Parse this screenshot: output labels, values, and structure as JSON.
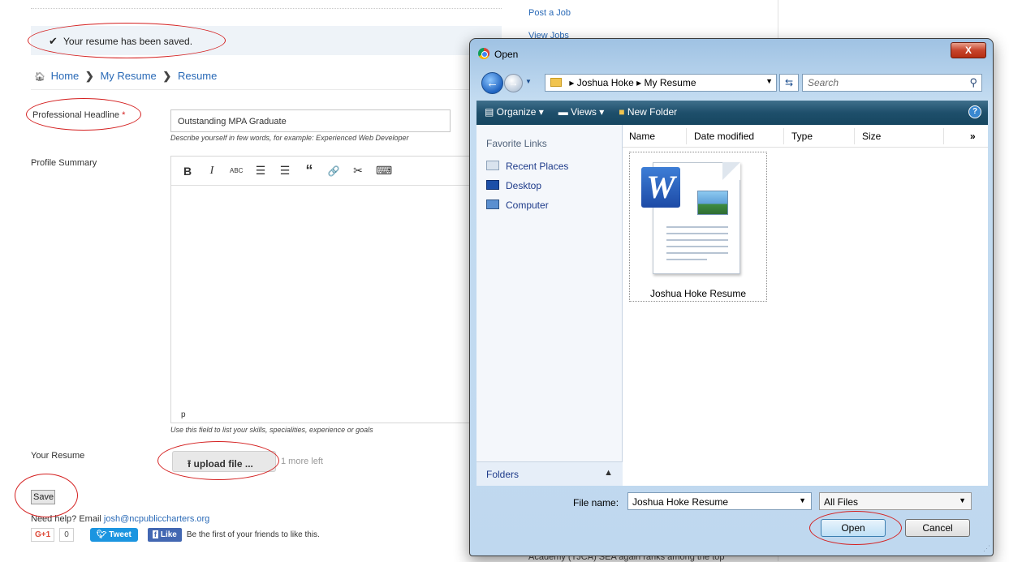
{
  "webpage": {
    "alert_message": "Your resume has been saved.",
    "breadcrumb": [
      "Home",
      "My Resume",
      "Resume"
    ],
    "headline_label": "Professional Headline",
    "headline_required_mark": "*",
    "headline_value": "Outstanding MPA Graduate",
    "headline_help": "Describe yourself in few words, for example: Experienced Web Developer",
    "summary_label": "Profile Summary",
    "editor_toolbar_icons": [
      "bold-icon",
      "italic-icon",
      "strikethrough-icon",
      "bulleted-list-icon",
      "numbered-list-icon",
      "quote-icon",
      "link-icon",
      "unlink-icon",
      "keyboard-icon"
    ],
    "editor_toolbar_glyphs": {
      "bold": "B",
      "italic": "I",
      "strike": "ABC",
      "ul": "☰",
      "ol": "☰",
      "quote": "“",
      "link": "🔗",
      "unlink": "✂",
      "keyboard": "⌨"
    },
    "editor_status": "p",
    "summary_help": "Use this field to list your skills, specialities, experience or goals",
    "resume_label": "Your Resume",
    "upload_button": "upload file ...",
    "upload_remaining": "1 more left",
    "save_button": "Save",
    "help_prefix": "Need help?  Email ",
    "help_email": "josh@ncpubliccharters.org",
    "social": {
      "gplus": "G+1",
      "gplus_count": "0",
      "tweet": "Tweet",
      "fb_like": "Like",
      "fb_text": "Be the first of your friends to like this."
    },
    "sidebar_links": [
      "Post a Job",
      "View Jobs"
    ],
    "sidebar_bottom_text": "Academy (TJCA) SEA again ranks among the top"
  },
  "dialog": {
    "title": "Open",
    "close_glyph": "X",
    "address_path": [
      "Joshua Hoke",
      "My Resume"
    ],
    "search_placeholder": "Search",
    "toolbar": [
      "Organize ▾",
      "Views ▾",
      "New Folder"
    ],
    "favorites_title": "Favorite Links",
    "favorites": [
      "Recent Places",
      "Desktop",
      "Computer"
    ],
    "folders_label": "Folders",
    "columns": [
      "Name",
      "Date modified",
      "Type",
      "Size",
      "»"
    ],
    "files": [
      {
        "name": "Joshua Hoke Resume",
        "icon": "word-document-icon"
      }
    ],
    "file_name_label": "File name:",
    "file_name_value": "Joshua Hoke Resume",
    "file_type_filter": "All Files",
    "open_button": "Open",
    "cancel_button": "Cancel"
  },
  "colors": {
    "annotation_red": "#d42020",
    "link_blue": "#2a6ab7",
    "dialog_frame": "#bfd8ef",
    "command_bar": "#1e4f6b"
  }
}
